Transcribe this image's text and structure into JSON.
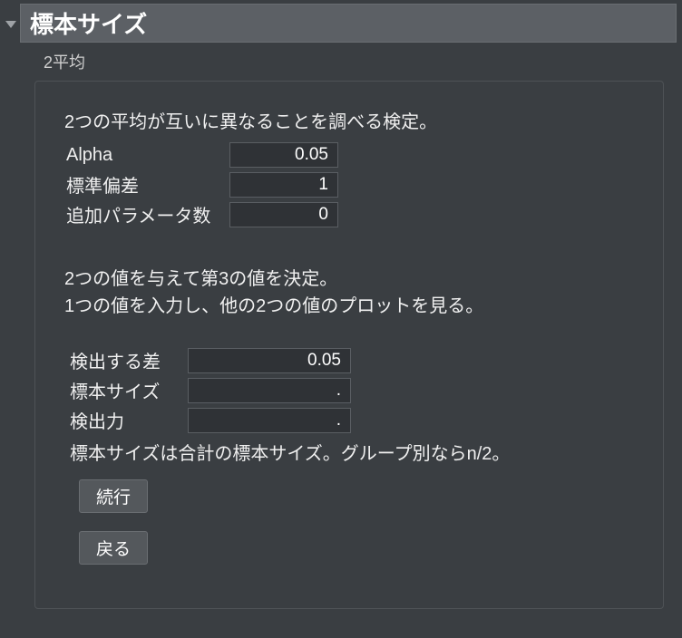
{
  "header": {
    "title": "標本サイズ",
    "subtitle": "2平均"
  },
  "panel": {
    "description1": "2つの平均が互いに異なることを調べる検定。",
    "params1": {
      "alpha": {
        "label": "Alpha",
        "value": "0.05"
      },
      "stddev": {
        "label": "標準偏差",
        "value": "1"
      },
      "extra": {
        "label": "追加パラメータ数",
        "value": "0"
      }
    },
    "description2_line1": "2つの値を与えて第3の値を決定。",
    "description2_line2": "1つの値を入力し、他の2つの値のプロットを見る。",
    "params2": {
      "diff": {
        "label": "検出する差",
        "value": "0.05"
      },
      "size": {
        "label": "標本サイズ",
        "value": "."
      },
      "power": {
        "label": "検出力",
        "value": "."
      }
    },
    "note": "標本サイズは合計の標本サイズ。グループ別ならn/2。",
    "buttons": {
      "continue": "続行",
      "back": "戻る"
    }
  }
}
